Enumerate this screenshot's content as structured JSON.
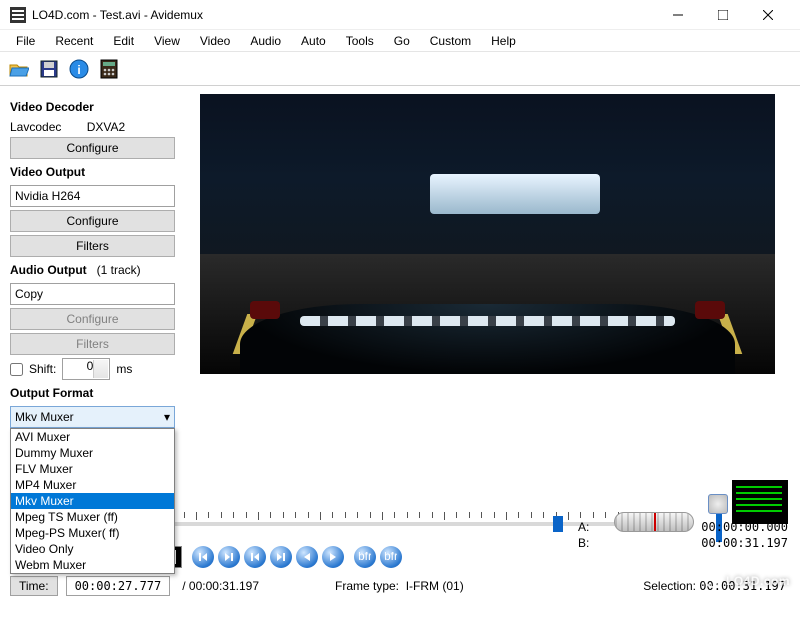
{
  "window": {
    "title": "LO4D.com - Test.avi - Avidemux"
  },
  "menu": [
    "File",
    "Recent",
    "Edit",
    "View",
    "Video",
    "Audio",
    "Auto",
    "Tools",
    "Go",
    "Custom",
    "Help"
  ],
  "toolbar_icons": [
    "open-icon",
    "save-icon",
    "info-icon",
    "calculator-icon"
  ],
  "panel": {
    "decoder": {
      "title": "Video Decoder",
      "name": "Lavcodec",
      "accel": "DXVA2",
      "configure": "Configure"
    },
    "voutput": {
      "title": "Video Output",
      "selected": "Nvidia H264",
      "configure": "Configure",
      "filters": "Filters"
    },
    "aoutput": {
      "title": "Audio Output",
      "tracks": "(1 track)",
      "selected": "Copy",
      "configure": "Configure",
      "filters": "Filters",
      "shift_label": "Shift:",
      "shift_value": "0",
      "shift_unit": "ms"
    },
    "oformat": {
      "title": "Output Format",
      "selected": "Mkv Muxer",
      "options": [
        "AVI Muxer",
        "Dummy Muxer",
        "FLV Muxer",
        "MP4 Muxer",
        "Mkv Muxer",
        "Mpeg TS Muxer (ff)",
        "Mpeg-PS Muxer( ff)",
        "Video Only",
        "Webm Muxer"
      ]
    }
  },
  "timeline": {
    "playhead_ratio": 0.89
  },
  "readout": {
    "a_label": "A:",
    "a_value": "00:00:00.000",
    "b_label": "B:",
    "b_value": "00:00:31.197",
    "sel_label": "Selection:",
    "sel_value": "00:00:31.197"
  },
  "status": {
    "time_label": "Time:",
    "time_value": "00:00:27.777",
    "duration": "/ 00:00:31.197",
    "frame_label": "Frame type:",
    "frame_value": "I-FRM (01)"
  },
  "watermark": "LO4D.com"
}
